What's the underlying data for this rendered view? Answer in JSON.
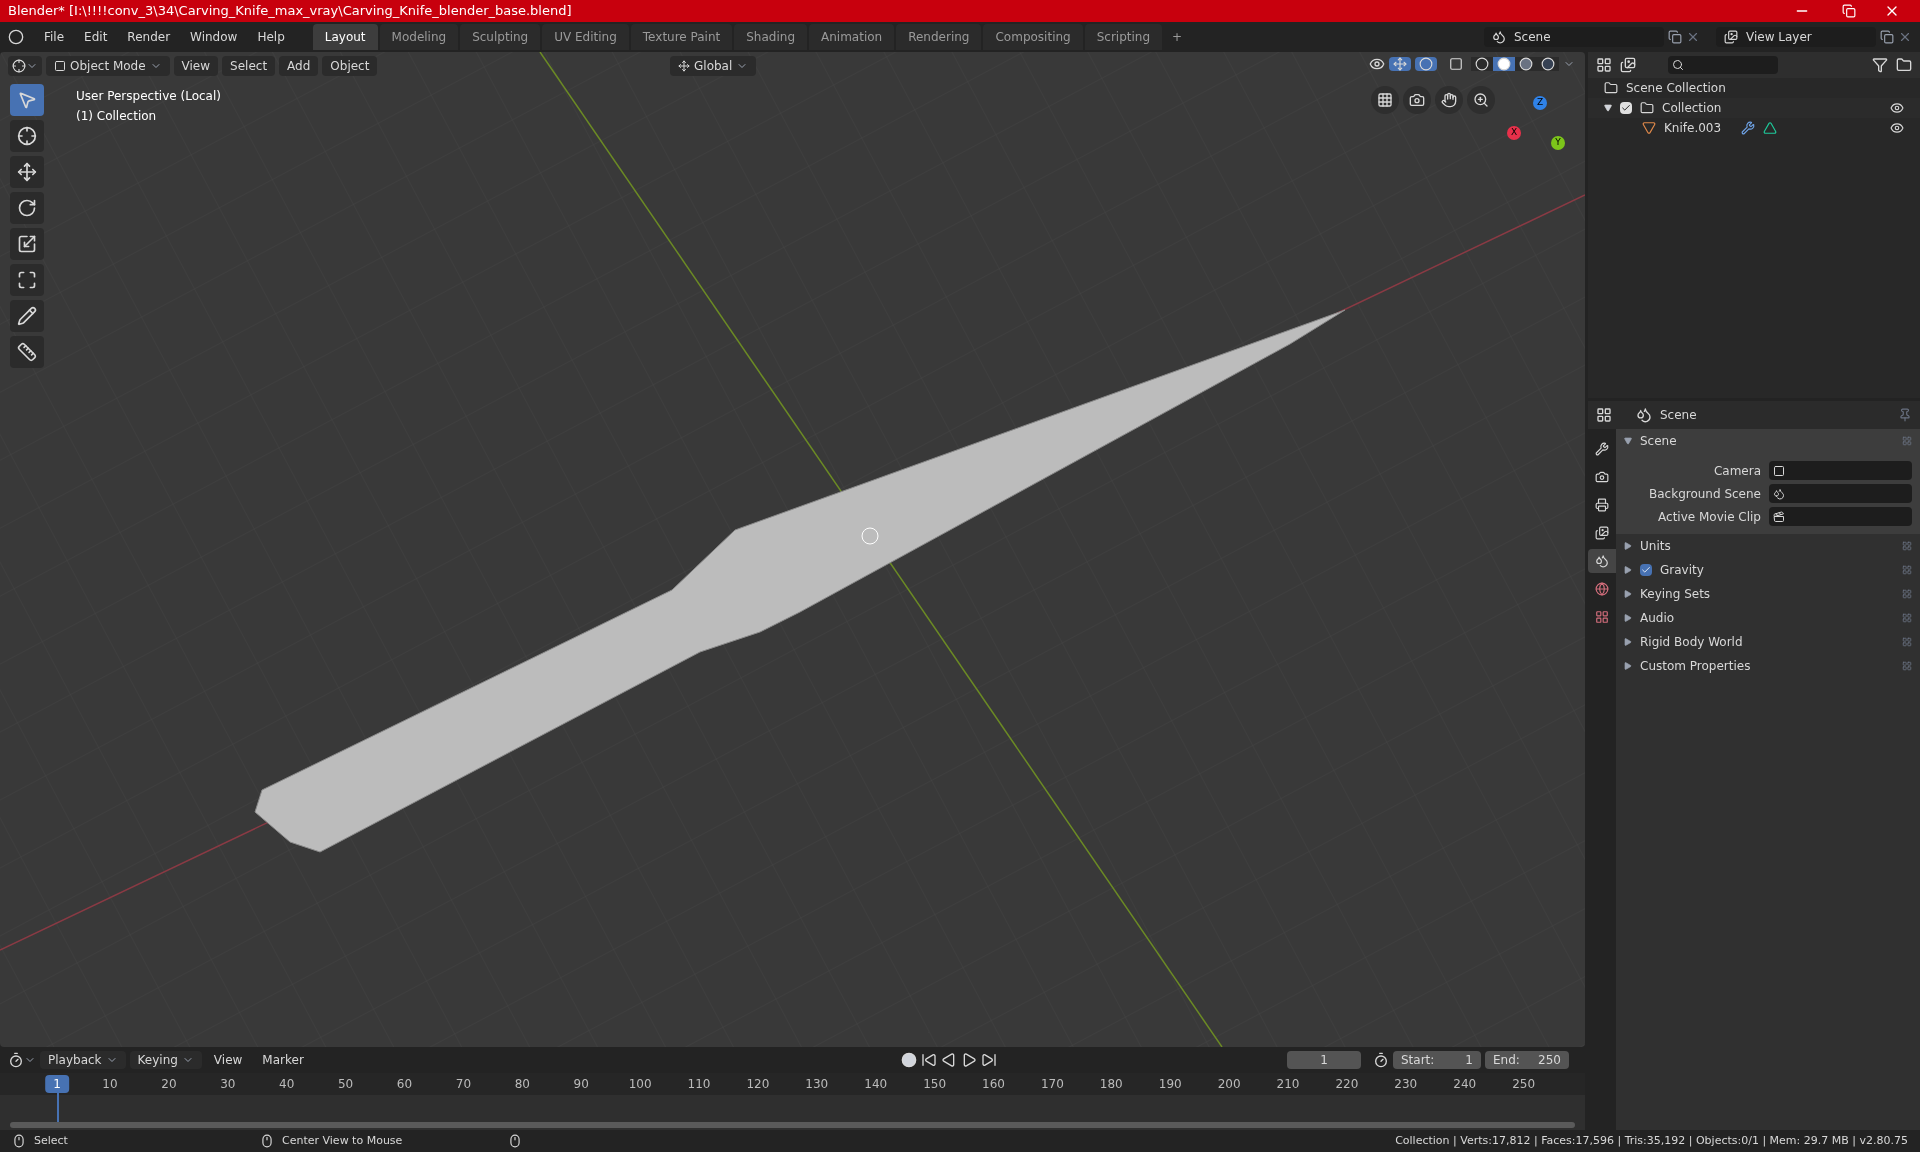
{
  "window": {
    "title": "Blender* [I:\\!!!!conv_3\\34\\Carving_Knife_max_vray\\Carving_Knife_blender_base.blend]"
  },
  "menu": [
    "File",
    "Edit",
    "Render",
    "Window",
    "Help"
  ],
  "workspaces": [
    {
      "label": "Layout",
      "selected": true
    },
    {
      "label": "Modeling",
      "selected": false
    },
    {
      "label": "Sculpting",
      "selected": false
    },
    {
      "label": "UV Editing",
      "selected": false
    },
    {
      "label": "Texture Paint",
      "selected": false
    },
    {
      "label": "Shading",
      "selected": false
    },
    {
      "label": "Animation",
      "selected": false
    },
    {
      "label": "Rendering",
      "selected": false
    },
    {
      "label": "Compositing",
      "selected": false
    },
    {
      "label": "Scripting",
      "selected": false
    }
  ],
  "add_workspace": "+",
  "scene": "Scene",
  "view_layer": "View Layer",
  "viewport": {
    "mode": "Object Mode",
    "menus": [
      "View",
      "Select",
      "Add",
      "Object"
    ],
    "orientation": "Global",
    "info": [
      "User Perspective (Local)",
      "(1) Collection"
    ],
    "shading": [
      {
        "kind": "wireframe",
        "selected": false
      },
      {
        "kind": "solid",
        "selected": true
      },
      {
        "kind": "material",
        "selected": false
      },
      {
        "kind": "rendered",
        "selected": false
      }
    ],
    "gizmo": {
      "x": "X",
      "y": "Y",
      "z": "Z"
    },
    "gizmos_on": true,
    "overlays_on": true,
    "tools": [
      {
        "kind": "select",
        "selected": true
      },
      {
        "kind": "cursor",
        "selected": false
      },
      {
        "kind": "move",
        "selected": false
      },
      {
        "kind": "rotate",
        "selected": false
      },
      {
        "kind": "scale",
        "selected": false
      },
      {
        "kind": "transform",
        "selected": false
      },
      {
        "kind": "annotate",
        "selected": false
      },
      {
        "kind": "measure",
        "selected": false
      }
    ]
  },
  "outliner": {
    "root": "Scene Collection",
    "children": [
      {
        "label": "Collection",
        "checked": true,
        "expanded": true,
        "children": [
          {
            "label": "Knife.003"
          }
        ]
      }
    ]
  },
  "properties": {
    "context": "Scene",
    "tabs": [
      {
        "kind": "tool",
        "selected": false
      },
      {
        "kind": "render",
        "selected": false
      },
      {
        "kind": "output",
        "selected": false
      },
      {
        "kind": "view_layer",
        "selected": false
      },
      {
        "kind": "scene",
        "selected": true
      },
      {
        "kind": "world",
        "selected": false
      },
      {
        "kind": "texture",
        "selected": false
      }
    ],
    "panels": [
      {
        "label": "Scene",
        "expanded": true,
        "fields": [
          {
            "label": "Camera",
            "kind": "camera"
          },
          {
            "label": "Background Scene",
            "kind": "scene"
          },
          {
            "label": "Active Movie Clip",
            "kind": "clip"
          }
        ]
      },
      {
        "label": "Units",
        "expanded": false
      },
      {
        "label": "Gravity",
        "expanded": false,
        "checked": true
      },
      {
        "label": "Keying Sets",
        "expanded": false
      },
      {
        "label": "Audio",
        "expanded": false
      },
      {
        "label": "Rigid Body World",
        "expanded": false
      },
      {
        "label": "Custom Properties",
        "expanded": false
      }
    ]
  },
  "timeline": {
    "menus": [
      "Playback",
      "Keying"
    ],
    "plain_menus": [
      "View",
      "Marker"
    ],
    "current_frame": "1",
    "start_label": "Start:",
    "start": "1",
    "end_label": "End:",
    "end": "250",
    "ruler": [
      {
        "label": "1",
        "selected": true
      },
      {
        "label": "10",
        "selected": false
      },
      {
        "label": "20",
        "selected": false
      },
      {
        "label": "30",
        "selected": false
      },
      {
        "label": "40",
        "selected": false
      },
      {
        "label": "50",
        "selected": false
      },
      {
        "label": "60",
        "selected": false
      },
      {
        "label": "70",
        "selected": false
      },
      {
        "label": "80",
        "selected": false
      },
      {
        "label": "90",
        "selected": false
      },
      {
        "label": "100",
        "selected": false
      },
      {
        "label": "110",
        "selected": false
      },
      {
        "label": "120",
        "selected": false
      },
      {
        "label": "130",
        "selected": false
      },
      {
        "label": "140",
        "selected": false
      },
      {
        "label": "150",
        "selected": false
      },
      {
        "label": "160",
        "selected": false
      },
      {
        "label": "170",
        "selected": false
      },
      {
        "label": "180",
        "selected": false
      },
      {
        "label": "190",
        "selected": false
      },
      {
        "label": "200",
        "selected": false
      },
      {
        "label": "210",
        "selected": false
      },
      {
        "label": "220",
        "selected": false
      },
      {
        "label": "230",
        "selected": false
      },
      {
        "label": "240",
        "selected": false
      },
      {
        "label": "250",
        "selected": false
      }
    ]
  },
  "status_bar": {
    "hints": [
      "Select",
      "Center View to Mouse"
    ],
    "stats": "Collection | Verts:17,812 | Faces:17,596 | Tris:35,192 | Objects:0/1 | Mem: 29.7 MB | v2.80.75"
  }
}
